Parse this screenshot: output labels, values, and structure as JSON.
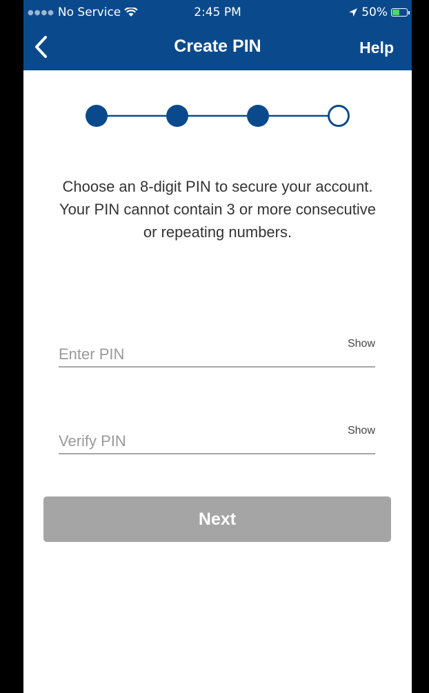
{
  "status_bar": {
    "carrier": "No Service",
    "time": "2:45 PM",
    "battery": "50%",
    "battery_level": 0.5
  },
  "header": {
    "title": "Create PIN",
    "help_label": "Help"
  },
  "stepper": {
    "total_steps": 4,
    "completed_steps": 3,
    "color": "#0a4a8c"
  },
  "instructions": "Choose an 8-digit PIN to secure your account. Your PIN cannot contain 3 or more consecutive or repeating numbers.",
  "form": {
    "enter_pin": {
      "placeholder": "Enter PIN",
      "value": "",
      "show_label": "Show"
    },
    "verify_pin": {
      "placeholder": "Verify PIN",
      "value": "",
      "show_label": "Show"
    }
  },
  "next_label": "Next",
  "colors": {
    "brand": "#0a4a8c",
    "button_disabled": "#a5a5a5"
  }
}
